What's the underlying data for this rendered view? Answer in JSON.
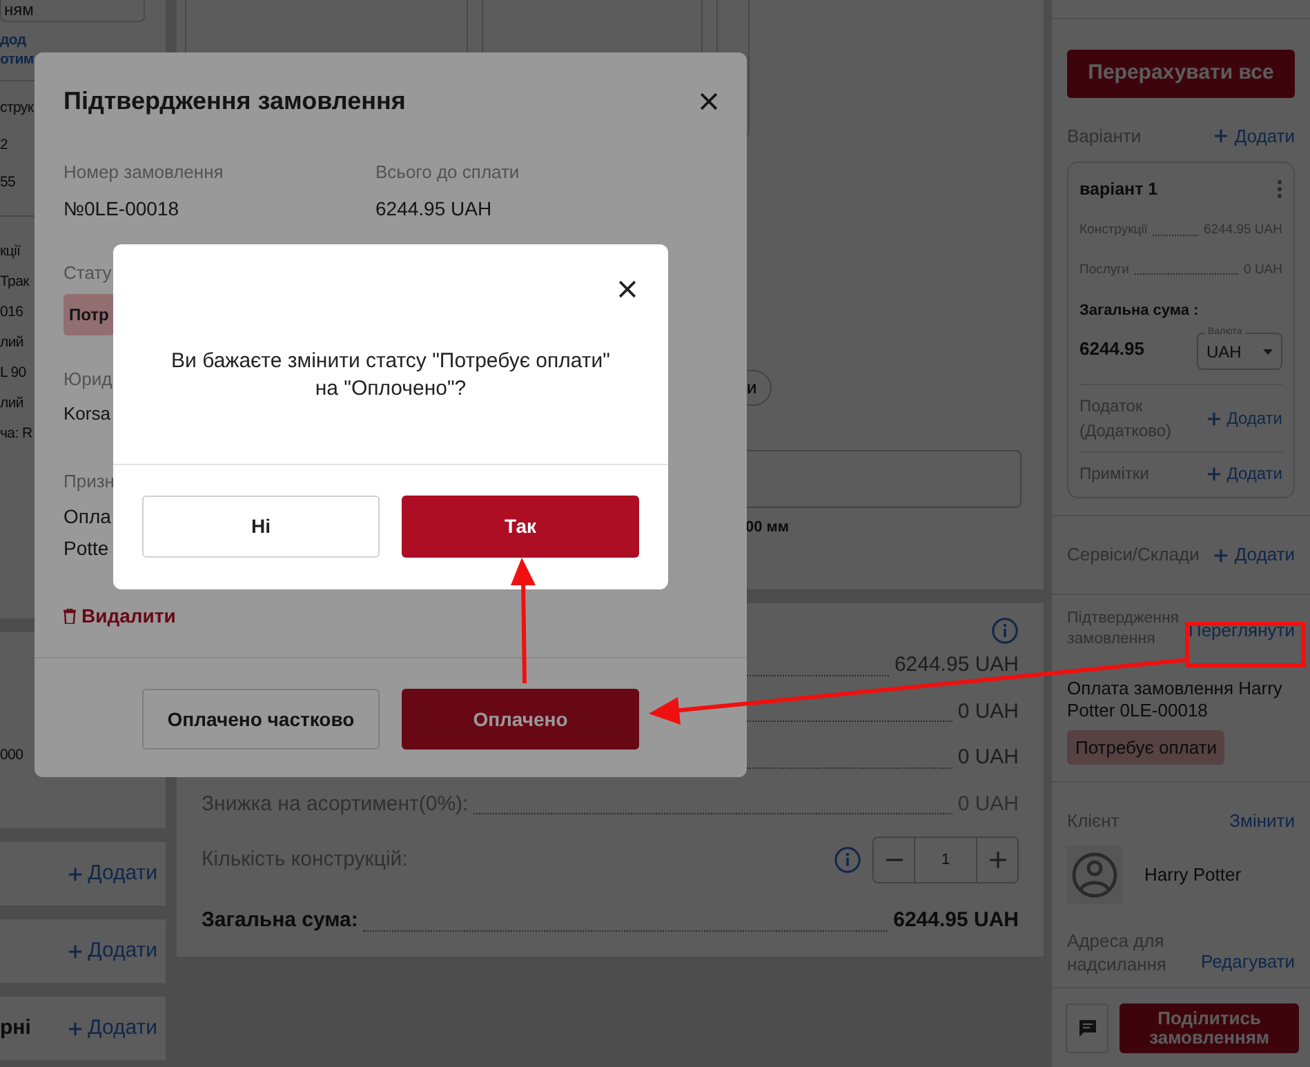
{
  "left_panel": {
    "field_text": "ням",
    "link_lines": [
      "дод",
      "отим"
    ],
    "group_1": [
      "струк",
      "2",
      "55"
    ],
    "group_2": [
      "кції",
      "Трак",
      "016",
      "лий",
      "L 90",
      "лий",
      "ча: R"
    ],
    "group_3": [
      "000"
    ],
    "add_rows": [
      {
        "add": "Додати"
      },
      {
        "add": "Додати"
      },
      {
        "label": "рні",
        "add": "Додати"
      }
    ]
  },
  "main": {
    "pill_button": "и",
    "dimension": "00 мм",
    "summary": {
      "rows": [
        {
          "value": "6244.95 UAH"
        },
        {
          "value": "0 UAH"
        },
        {
          "value": "0 UAH"
        },
        {
          "label": "Знижка на асортимент(0%):",
          "value": "0 UAH"
        }
      ],
      "quantity": {
        "label": "Кількість конструкцій:",
        "value": "1"
      },
      "total": {
        "label": "Загальна сума:",
        "value": "6244.95 UAH"
      }
    }
  },
  "sidebar": {
    "recalc_button": "Перерахувати все",
    "variants": {
      "label": "Варіанти",
      "add": "Додати",
      "card": {
        "title": "варіант 1",
        "lines": [
          {
            "label": "Конструкції",
            "value": "6244.95 UAH"
          },
          {
            "label": "Послуги",
            "value": "0 UAH"
          }
        ],
        "total_label": "Загальна сума :",
        "total_value": "6244.95",
        "currency": {
          "label": "Валюта",
          "value": "UAH"
        },
        "extras": [
          {
            "label": "Податок (Додатково)",
            "add": "Додати"
          },
          {
            "label": "Примітки",
            "add": "Додати"
          }
        ]
      }
    },
    "services": {
      "label": "Сервіси/Склади",
      "add": "Додати"
    },
    "confirmation": {
      "label": "Підтвердження замовлення",
      "link": "Переглянути",
      "text": "Оплата замовлення Harry Potter 0LE-00018",
      "status": "Потребує оплати"
    },
    "client": {
      "label": "Клієнт",
      "link": "Змінити",
      "name": "Harry Potter"
    },
    "address": {
      "label": "Адреса для надсилання",
      "link": "Редагувати"
    },
    "share_button": "Поділитись замовленням"
  },
  "order_dialog": {
    "title": "Підтвердження замовлення",
    "fields": [
      {
        "label": "Номер замовлення",
        "value": "№0LE-00018"
      },
      {
        "label": "Всього до сплати",
        "value": "6244.95 UAH"
      }
    ],
    "status_label": "Стату",
    "status": "Потр",
    "legal_label": "Юрид",
    "legal_value": "Korsa",
    "purpose_label": "Призн",
    "purpose_lines": [
      "Опла",
      "Potte"
    ],
    "delete": "Видалити",
    "buttons": [
      {
        "label": "Оплачено частково",
        "kind": "outline"
      },
      {
        "label": "Оплачено",
        "kind": "primary"
      }
    ]
  },
  "confirm_dialog": {
    "message": "Ви бажаєте змінити статсу \"Потребує оплати\" на \"Оплочено\"?",
    "buttons": [
      {
        "label": "Ні",
        "kind": "outline"
      },
      {
        "label": "Так",
        "kind": "primary"
      }
    ]
  }
}
